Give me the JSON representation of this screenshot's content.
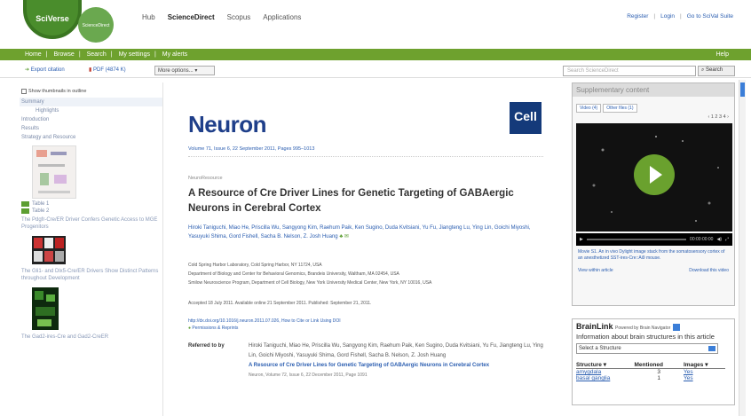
{
  "header": {
    "sciverse_logo": "SciVerse",
    "sciencedirect_logo": "ScienceDirect",
    "nav": [
      "Hub",
      "ScienceDirect",
      "Scopus",
      "Applications"
    ],
    "active_nav": "ScienceDirect",
    "links": [
      "Register",
      "Login",
      "Go to SciVal Suite"
    ]
  },
  "greenbar": {
    "items": [
      "Home",
      "Browse",
      "Search",
      "My settings",
      "My alerts"
    ],
    "help": "Help"
  },
  "toolbar": {
    "export": "Export citation",
    "pdf": "PDF (4874 K)",
    "more": "More options...",
    "search_placeholder": "Search ScienceDirect",
    "search_button": "Search"
  },
  "sidebar": {
    "thumbnails_label": "Show thumbnails in outline",
    "outline": [
      "Summary",
      "Highlights",
      "Introduction",
      "Results",
      "Strategy and Resource"
    ],
    "tables": [
      "Table 1",
      "Table 2"
    ],
    "captions": [
      "The Pdgfr-Cre/ER Driver Confers Genetic Access to MGE Progenitors",
      "The Gli1- and Dlx5-Cre/ER Drivers Show Distinct Patterns throughout Development",
      "The Gad2-ires-Cre and Gad2-CreER"
    ]
  },
  "article": {
    "journal": "Neuron",
    "publisher_logo": "Cell",
    "volume_info": "Volume 71, Issue 6, 22 September 2011, Pages 995–1013",
    "section": "NeuroResource",
    "title": "A Resource of Cre Driver Lines for Genetic Targeting of GABAergic Neurons in Cerebral Cortex",
    "authors": "Hiroki Taniguchi, Miao He, Priscilla Wu, Sangyong Kim, Raehum Paik, Ken Sugino, Duda Kvitsiani, Yu Fu, Jiangteng Lu, Ying Lin, Goichi Miyoshi, Yasuyuki Shima, Gord Fishell, Sacha B. Nelson, Z. Josh Huang",
    "affiliations": [
      "Cold Spring Harbor Laboratory, Cold Spring Harbor, NY 11724, USA",
      "Department of Biology and Center for Behavioral Genomics, Brandeis University, Waltham, MA 02454, USA",
      "Smilow Neuroscience Program, Department of Cell Biology, New York University Medical Center, New York, NY 10016, USA"
    ],
    "dates": "Accepted 18 July 2011. Available online 21 September 2011. Published: September 21, 2011.",
    "doi": "http://dx.doi.org/10.1016/j.neuron.2011.07.026, How to Cite or Link Using DOI",
    "permissions": "Permissions & Reprints",
    "referred_label": "Referred to by",
    "referred_authors": "Hiroki Taniguchi, Miao He, Priscilla Wu, Sangyong Kim, Raehum Paik, Ken Sugino, Duda Kvitsiani, Yu Fu, Jiangteng Lu, Ying Lin, Goichi Miyoshi, Yasuyuki Shima, Gord Fishell, Sacha B. Nelson, Z. Josh Huang",
    "referred_title": "A Resource of Cre Driver Lines for Genetic Targeting of GABAergic Neurons in Cerebral Cortex",
    "referred_journal": "Neuron, Volume 72, Issue 6, 22 December 2011, Page 1091"
  },
  "supplementary": {
    "header": "Supplementary content",
    "tabs": [
      "Video (4)",
      "Other files (1)"
    ],
    "pager": "‹  1 2 3 4  ›",
    "time": "00:00:00:00",
    "caption": "Movie S1. An in vivo Dylight image stack from the somatosensory cortex of an anesthetized SST-ires-Cre::Ai9 mouse.",
    "view_link": "View within article",
    "download_link": "Download this video"
  },
  "brainlink": {
    "title": "BrainLink",
    "powered": "Powered by Brain Navigator",
    "info": "Information about brain structures in this article",
    "select": "Select a Structure",
    "columns": [
      "Structure",
      "Mentioned",
      "Images"
    ],
    "rows": [
      {
        "structure": "amygdala",
        "mentioned": "3",
        "images": "Yes"
      },
      {
        "structure": "basal ganglia",
        "mentioned": "1",
        "images": "Yes"
      }
    ]
  }
}
